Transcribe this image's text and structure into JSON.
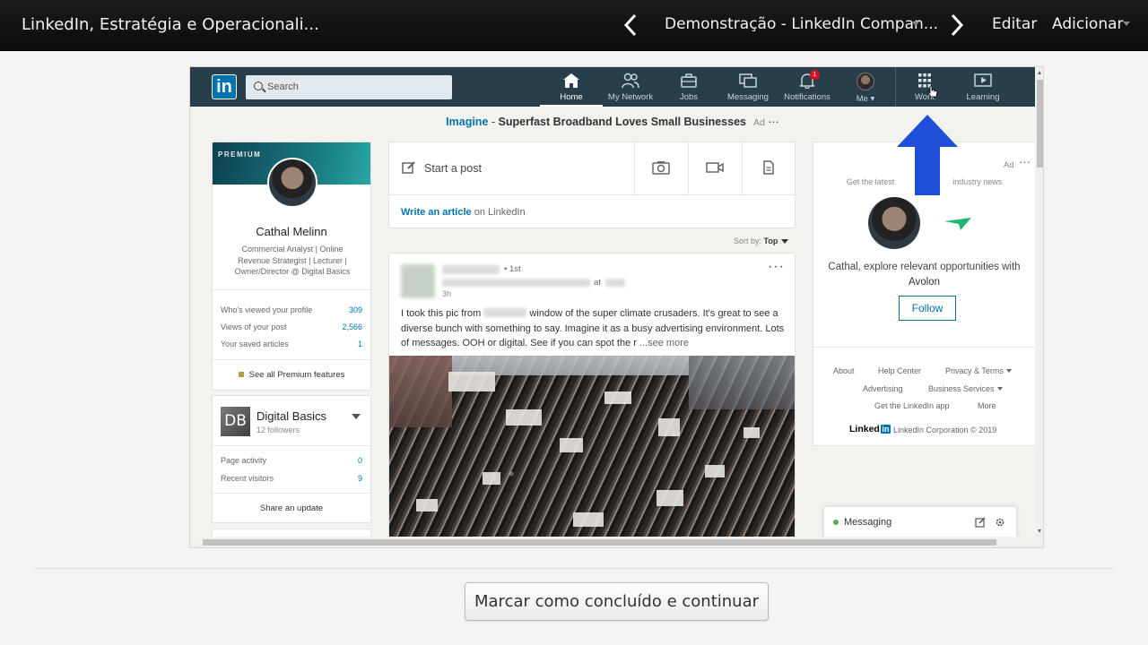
{
  "topbar": {
    "course_title": "LinkedIn, Estratégia e Operacionali...",
    "lesson_title": "Demonstração - LinkedIn Compan...",
    "edit_label": "Editar",
    "add_label": "Adicionar"
  },
  "linkedin": {
    "logo_text": "in",
    "search_placeholder": "Search",
    "nav": [
      {
        "label": "Home",
        "icon": "home-icon"
      },
      {
        "label": "My Network",
        "icon": "people-icon"
      },
      {
        "label": "Jobs",
        "icon": "briefcase-icon"
      },
      {
        "label": "Messaging",
        "icon": "chat-icon"
      },
      {
        "label": "Notifications",
        "icon": "bell-icon",
        "badge": "1"
      },
      {
        "label": "Me",
        "icon": "avatar"
      },
      {
        "label": "Work",
        "icon": "grid-icon"
      },
      {
        "label": "Learning",
        "icon": "play-icon"
      }
    ],
    "ad_line": {
      "brand": "Imagine",
      "separator": " - ",
      "headline": "Superfast Broadband Loves Small Businesses",
      "tag": "Ad",
      "more": "···"
    },
    "profile": {
      "badge": "PREMIUM",
      "name": "Cathal Melinn",
      "headline": "Commercial Analyst | Online Revenue Strategist | Lecturer | Owner/Director @ Digital Basics",
      "stats": [
        {
          "label": "Who's viewed your profile",
          "value": "309"
        },
        {
          "label": "Views of your post",
          "value": "2,566"
        },
        {
          "label": "Your saved articles",
          "value": "1"
        }
      ],
      "premium_link": "See all Premium features"
    },
    "page_card": {
      "logo": "DB",
      "name": "Digital Basics",
      "followers": "12 followers",
      "stats": [
        {
          "label": "Page activity",
          "value": "0"
        },
        {
          "label": "Recent visitors",
          "value": "9"
        }
      ],
      "share": "Share an update"
    },
    "share_box": {
      "start_post": "Start a post",
      "write_article": "Write an article",
      "write_suffix": " on LinkedIn",
      "sort_label": "Sort by: ",
      "sort_value": "Top"
    },
    "post": {
      "degree": "• 1st",
      "at": "at",
      "time": "3h",
      "more": "···",
      "text_1": "I took this pic from ",
      "text_2": " window of the super climate crusaders. It's great to see a diverse bunch with something to say. Imagine it as a busy  advertising environment. Lots of messages. OOH or digital. See if you can spot the r",
      "see_more": " ...see more"
    },
    "ad_card": {
      "ad_tag": "Ad",
      "more": "···",
      "latest_pre": "Get the latest ",
      "latest_post": " industry news",
      "message": "Cathal, explore relevant opportunities with ",
      "company": "Avolon",
      "follow": "Follow",
      "footer": {
        "about": "About",
        "help": "Help Center",
        "privacy": "Privacy & Terms",
        "advertising": "Advertising",
        "business": "Business Services",
        "app": "Get the LinkedIn app",
        "more": "More",
        "brand": "Linked",
        "brand_in": "in",
        "copyright": "LinkedIn Corporation © 2019"
      }
    },
    "messaging": "Messaging"
  },
  "bottom": {
    "continue_label": "Marcar como concluído e continuar"
  },
  "colors": {
    "linkedin_nav": "#283e4a",
    "linkedin_blue": "#0073b1",
    "arrow_blue": "#1f4fd8"
  }
}
